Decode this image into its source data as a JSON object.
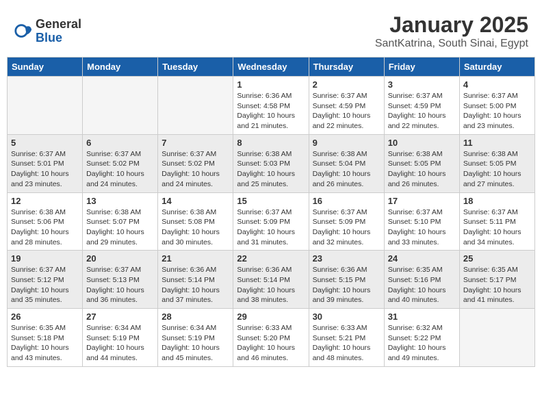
{
  "header": {
    "logo_general": "General",
    "logo_blue": "Blue",
    "month_title": "January 2025",
    "location": "SantKatrina, South Sinai, Egypt"
  },
  "weekdays": [
    "Sunday",
    "Monday",
    "Tuesday",
    "Wednesday",
    "Thursday",
    "Friday",
    "Saturday"
  ],
  "weeks": [
    [
      {
        "day": null
      },
      {
        "day": null
      },
      {
        "day": null
      },
      {
        "day": "1",
        "sunrise": "6:36 AM",
        "sunset": "4:58 PM",
        "daylight": "10 hours and 21 minutes."
      },
      {
        "day": "2",
        "sunrise": "6:37 AM",
        "sunset": "4:59 PM",
        "daylight": "10 hours and 22 minutes."
      },
      {
        "day": "3",
        "sunrise": "6:37 AM",
        "sunset": "4:59 PM",
        "daylight": "10 hours and 22 minutes."
      },
      {
        "day": "4",
        "sunrise": "6:37 AM",
        "sunset": "5:00 PM",
        "daylight": "10 hours and 23 minutes."
      }
    ],
    [
      {
        "day": "5",
        "sunrise": "6:37 AM",
        "sunset": "5:01 PM",
        "daylight": "10 hours and 23 minutes."
      },
      {
        "day": "6",
        "sunrise": "6:37 AM",
        "sunset": "5:02 PM",
        "daylight": "10 hours and 24 minutes."
      },
      {
        "day": "7",
        "sunrise": "6:37 AM",
        "sunset": "5:02 PM",
        "daylight": "10 hours and 24 minutes."
      },
      {
        "day": "8",
        "sunrise": "6:38 AM",
        "sunset": "5:03 PM",
        "daylight": "10 hours and 25 minutes."
      },
      {
        "day": "9",
        "sunrise": "6:38 AM",
        "sunset": "5:04 PM",
        "daylight": "10 hours and 26 minutes."
      },
      {
        "day": "10",
        "sunrise": "6:38 AM",
        "sunset": "5:05 PM",
        "daylight": "10 hours and 26 minutes."
      },
      {
        "day": "11",
        "sunrise": "6:38 AM",
        "sunset": "5:05 PM",
        "daylight": "10 hours and 27 minutes."
      }
    ],
    [
      {
        "day": "12",
        "sunrise": "6:38 AM",
        "sunset": "5:06 PM",
        "daylight": "10 hours and 28 minutes."
      },
      {
        "day": "13",
        "sunrise": "6:38 AM",
        "sunset": "5:07 PM",
        "daylight": "10 hours and 29 minutes."
      },
      {
        "day": "14",
        "sunrise": "6:38 AM",
        "sunset": "5:08 PM",
        "daylight": "10 hours and 30 minutes."
      },
      {
        "day": "15",
        "sunrise": "6:37 AM",
        "sunset": "5:09 PM",
        "daylight": "10 hours and 31 minutes."
      },
      {
        "day": "16",
        "sunrise": "6:37 AM",
        "sunset": "5:09 PM",
        "daylight": "10 hours and 32 minutes."
      },
      {
        "day": "17",
        "sunrise": "6:37 AM",
        "sunset": "5:10 PM",
        "daylight": "10 hours and 33 minutes."
      },
      {
        "day": "18",
        "sunrise": "6:37 AM",
        "sunset": "5:11 PM",
        "daylight": "10 hours and 34 minutes."
      }
    ],
    [
      {
        "day": "19",
        "sunrise": "6:37 AM",
        "sunset": "5:12 PM",
        "daylight": "10 hours and 35 minutes."
      },
      {
        "day": "20",
        "sunrise": "6:37 AM",
        "sunset": "5:13 PM",
        "daylight": "10 hours and 36 minutes."
      },
      {
        "day": "21",
        "sunrise": "6:36 AM",
        "sunset": "5:14 PM",
        "daylight": "10 hours and 37 minutes."
      },
      {
        "day": "22",
        "sunrise": "6:36 AM",
        "sunset": "5:14 PM",
        "daylight": "10 hours and 38 minutes."
      },
      {
        "day": "23",
        "sunrise": "6:36 AM",
        "sunset": "5:15 PM",
        "daylight": "10 hours and 39 minutes."
      },
      {
        "day": "24",
        "sunrise": "6:35 AM",
        "sunset": "5:16 PM",
        "daylight": "10 hours and 40 minutes."
      },
      {
        "day": "25",
        "sunrise": "6:35 AM",
        "sunset": "5:17 PM",
        "daylight": "10 hours and 41 minutes."
      }
    ],
    [
      {
        "day": "26",
        "sunrise": "6:35 AM",
        "sunset": "5:18 PM",
        "daylight": "10 hours and 43 minutes."
      },
      {
        "day": "27",
        "sunrise": "6:34 AM",
        "sunset": "5:19 PM",
        "daylight": "10 hours and 44 minutes."
      },
      {
        "day": "28",
        "sunrise": "6:34 AM",
        "sunset": "5:19 PM",
        "daylight": "10 hours and 45 minutes."
      },
      {
        "day": "29",
        "sunrise": "6:33 AM",
        "sunset": "5:20 PM",
        "daylight": "10 hours and 46 minutes."
      },
      {
        "day": "30",
        "sunrise": "6:33 AM",
        "sunset": "5:21 PM",
        "daylight": "10 hours and 48 minutes."
      },
      {
        "day": "31",
        "sunrise": "6:32 AM",
        "sunset": "5:22 PM",
        "daylight": "10 hours and 49 minutes."
      },
      {
        "day": null
      }
    ]
  ],
  "labels": {
    "sunrise": "Sunrise:",
    "sunset": "Sunset:",
    "daylight": "Daylight:"
  }
}
